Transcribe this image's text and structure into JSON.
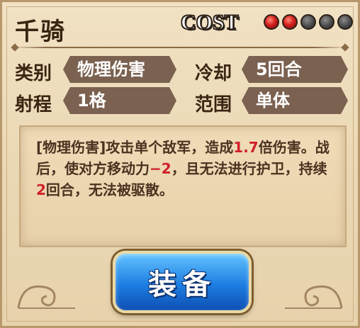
{
  "skill": {
    "name": "千骑",
    "cost_label": "COST",
    "cost": {
      "total": 5,
      "filled": 2
    }
  },
  "stats": {
    "category_label": "类别",
    "category_value": "物理伤害",
    "cooldown_label": "冷却",
    "cooldown_value": "5回合",
    "range_label": "射程",
    "range_value": "1格",
    "area_label": "范围",
    "area_value": "单体"
  },
  "description": {
    "p1": "[物理伤害]攻击单个敌军，造成",
    "v1": "1.7",
    "p2": "倍伤害。战后，使对方移动力",
    "v2": "−2",
    "p3": "，且无法进行护卫，持续",
    "v3": "2",
    "p4": "回合，无法被驱散。",
    "highlight_color": "#d0202a"
  },
  "buttons": {
    "equip_label": "装备"
  },
  "colors": {
    "tag_bg": "#7b6150",
    "equip_button": "#1e7ee2"
  }
}
